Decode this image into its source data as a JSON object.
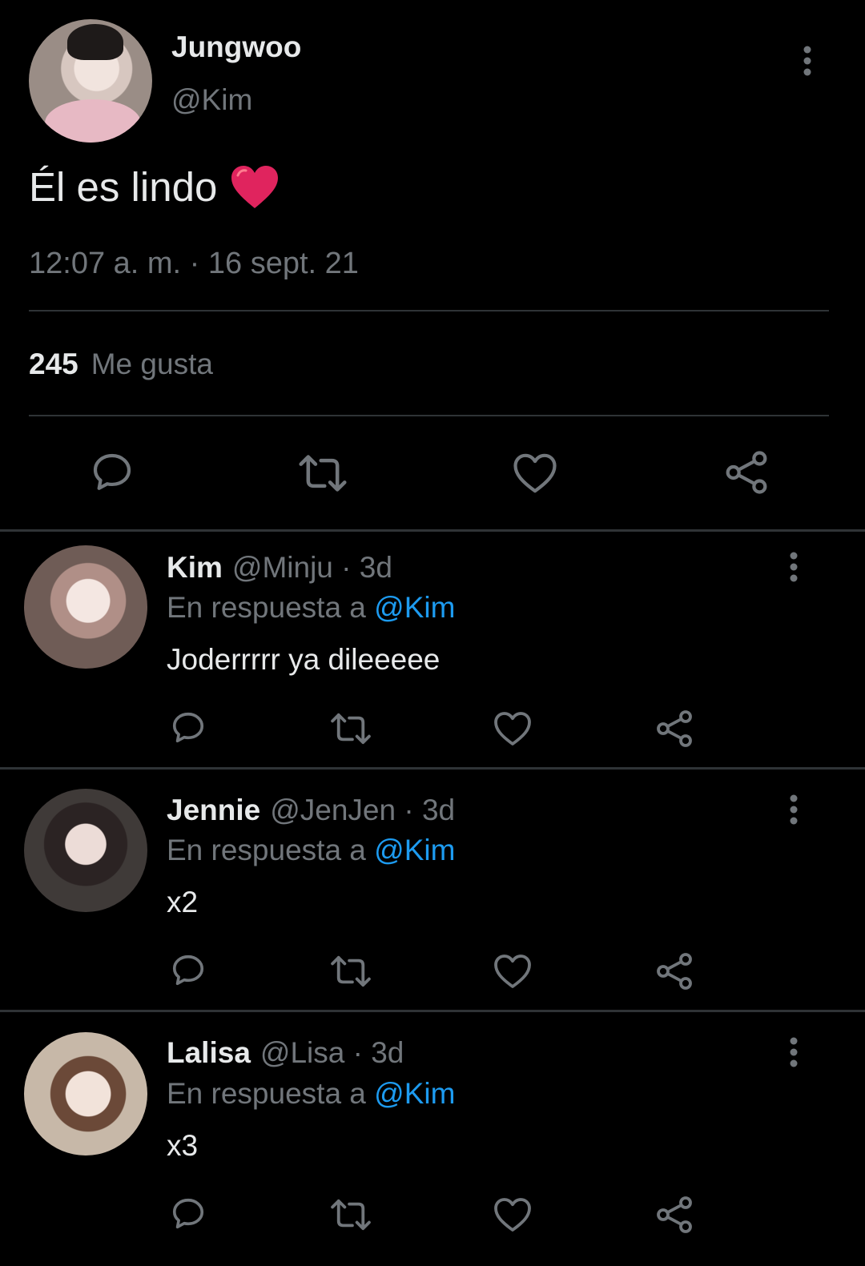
{
  "tweet": {
    "author_name": "Jungwoo",
    "author_handle": "@Kim",
    "text": "Él es lindo",
    "emoji": "❤️",
    "timestamp": "12:07 a. m. · 16 sept. 21",
    "likes_count": "245",
    "likes_label": "Me gusta"
  },
  "replies": [
    {
      "name": "Kim",
      "handle": "@Minju",
      "age": "· 3d",
      "reply_prefix": "En respuesta a",
      "reply_to": "@Kim",
      "text": "Joderrrrr ya dileeeee"
    },
    {
      "name": "Jennie",
      "handle": "@JenJen",
      "age": "· 3d",
      "reply_prefix": "En respuesta a",
      "reply_to": "@Kim",
      "text": "x2"
    },
    {
      "name": "Lalisa",
      "handle": "@Lisa",
      "age": "· 3d",
      "reply_prefix": "En respuesta a",
      "reply_to": "@Kim",
      "text": "x3"
    }
  ],
  "colors": {
    "background": "#000000",
    "text": "#e7e9ea",
    "muted": "#71767b",
    "link": "#1d9bf0",
    "heart": "#e0245e"
  },
  "icons": [
    "reply-icon",
    "retweet-icon",
    "like-icon",
    "share-icon",
    "more-icon"
  ]
}
